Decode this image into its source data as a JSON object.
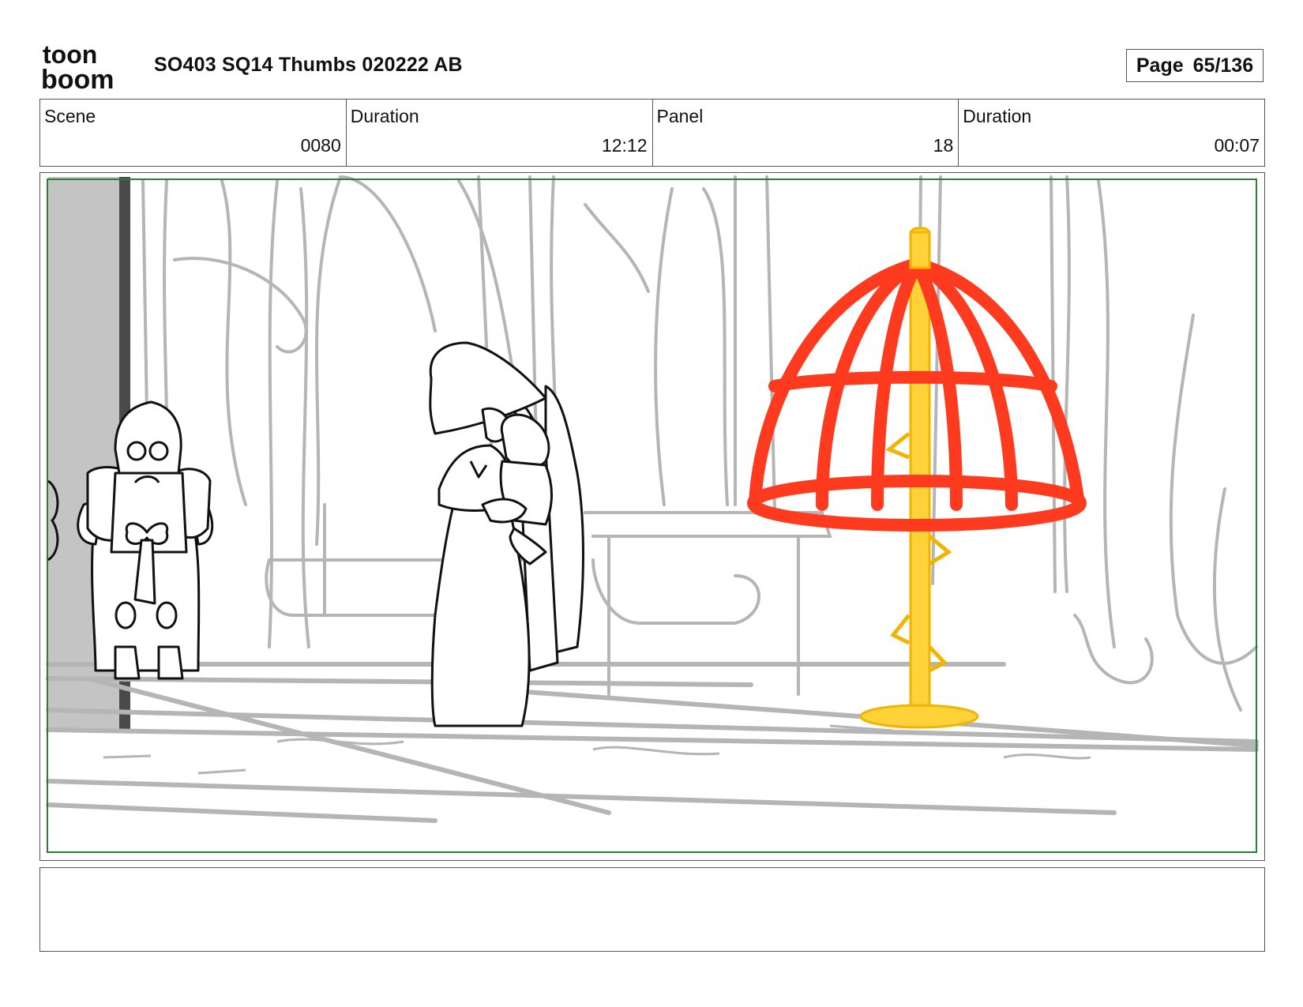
{
  "header": {
    "logo_top": "toon",
    "logo_bottom": "boom",
    "title": "SO403 SQ14 Thumbs 020222 AB",
    "page_label": "Page",
    "page_value": "65/136"
  },
  "info": [
    {
      "label": "Scene",
      "value": "0080"
    },
    {
      "label": "Duration",
      "value": "12:12"
    },
    {
      "label": "Panel",
      "value": "18"
    },
    {
      "label": "Duration",
      "value": "00:07"
    }
  ],
  "colors": {
    "frame_border": "#2e7d32",
    "cage": "#ff3b1f",
    "pole": "#ffd23a",
    "background_lines": "#b5b5b5",
    "left_wall": "#c4c4c4"
  },
  "icons": {
    "logo": "toonboom-logo"
  }
}
